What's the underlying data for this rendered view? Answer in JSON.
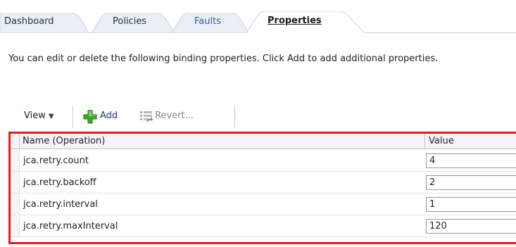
{
  "tabs": [
    {
      "label": "Dashboard",
      "selected": false
    },
    {
      "label": "Policies",
      "selected": false
    },
    {
      "label": "Faults",
      "selected": false
    },
    {
      "label": "Properties",
      "selected": true
    }
  ],
  "description": "You can edit or delete the following binding properties. Click Add to add additional properties.",
  "toolbar": {
    "view_label": "View",
    "add_label": "Add",
    "revert_label": "Revert..."
  },
  "table": {
    "columns": [
      "Name (Operation)",
      "Value"
    ],
    "rows": [
      {
        "name": "jca.retry.count",
        "value": "4"
      },
      {
        "name": "jca.retry.backoff",
        "value": "2"
      },
      {
        "name": "jca.retry.interval",
        "value": "1"
      },
      {
        "name": "jca.retry.maxInterval",
        "value": "120"
      }
    ]
  },
  "colors": {
    "highlight_border": "#e8191f",
    "tab_fill": "#e9eff5",
    "faults_text": "#2f5f9c",
    "add_icon": "#2e9e1f"
  },
  "icons": {
    "view_menu": "chevron-down-icon",
    "add": "plus-icon",
    "revert": "revert-icon"
  }
}
